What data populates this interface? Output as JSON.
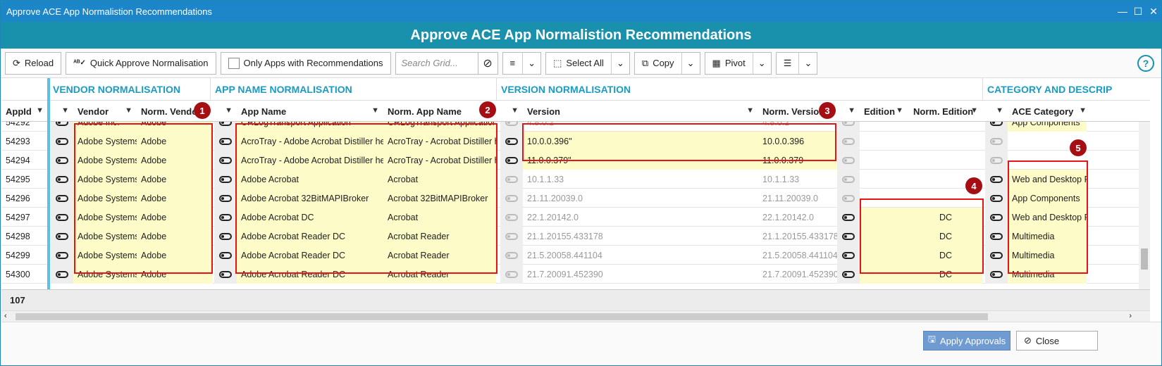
{
  "window": {
    "title": "Approve ACE App Normalistion Recommendations",
    "controls": {
      "minimize": "—",
      "maximize": "☐",
      "close": "✕"
    }
  },
  "header": {
    "title": "Approve ACE App Normalistion Recommendations"
  },
  "toolbar": {
    "reload": "Reload",
    "quick_approve": "Quick Approve Normalisation",
    "only_apps": "Only Apps with Recommendations",
    "search_placeholder": "Search Grid...",
    "select_all": "Select All",
    "copy": "Copy",
    "pivot": "Pivot",
    "help": "?"
  },
  "groups": {
    "vendor": "VENDOR NORMALISATION",
    "app": "APP NAME NORMALISATION",
    "version": "VERSION NORMALISATION",
    "category": "CATEGORY AND DESCRIP"
  },
  "columns": {
    "appid": "AppId",
    "vendor": "Vendor",
    "norm_vendor": "Norm. Vendor",
    "app_name": "App Name",
    "norm_app": "Norm. App Name",
    "version": "Version",
    "norm_version": "Norm. Version",
    "edition": "Edition",
    "norm_edition": "Norm. Edition",
    "ace_category": "ACE Category"
  },
  "rows": [
    {
      "appid": "54292",
      "vendor": "Adobe Inc.",
      "norm_vendor": "Adobe",
      "app": "CRLogTransport Application",
      "norm_app": "CRLogTransport Application",
      "version": "4.8.0.2",
      "norm_version": "4.8.0.2",
      "edition": "",
      "norm_edition": "",
      "category": "App Components"
    },
    {
      "appid": "54293",
      "vendor": "Adobe Systems",
      "norm_vendor": "Adobe",
      "app": "AcroTray - Adobe Acrobat Distiller helper",
      "norm_app": "AcroTray - Acrobat Distiller helper",
      "version": "10.0.0.396\"",
      "norm_version": "10.0.0.396",
      "edition": "",
      "norm_edition": "",
      "category": ""
    },
    {
      "appid": "54294",
      "vendor": "Adobe Systems",
      "norm_vendor": "Adobe",
      "app": "AcroTray - Adobe Acrobat Distiller helper",
      "norm_app": "AcroTray - Acrobat Distiller helper",
      "version": "11.0.0.379\"",
      "norm_version": "11.0.0.379",
      "edition": "",
      "norm_edition": "",
      "category": ""
    },
    {
      "appid": "54295",
      "vendor": "Adobe Systems",
      "norm_vendor": "Adobe",
      "app": "Adobe Acrobat",
      "norm_app": "Acrobat",
      "version": "10.1.1.33",
      "norm_version": "10.1.1.33",
      "edition": "",
      "norm_edition": "",
      "category": "Web and Desktop Publishing"
    },
    {
      "appid": "54296",
      "vendor": "Adobe Systems",
      "norm_vendor": "Adobe",
      "app": "Adobe Acrobat 32BitMAPIBroker",
      "norm_app": "Acrobat 32BitMAPIBroker",
      "version": "21.11.20039.0",
      "norm_version": "21.11.20039.0",
      "edition": "",
      "norm_edition": "",
      "category": "App Components"
    },
    {
      "appid": "54297",
      "vendor": "Adobe Systems",
      "norm_vendor": "Adobe",
      "app": "Adobe Acrobat DC",
      "norm_app": "Acrobat",
      "version": "22.1.20142.0",
      "norm_version": "22.1.20142.0",
      "edition": "",
      "norm_edition": "DC",
      "category": "Web and Desktop Publishing"
    },
    {
      "appid": "54298",
      "vendor": "Adobe Systems",
      "norm_vendor": "Adobe",
      "app": "Adobe Acrobat Reader DC",
      "norm_app": "Acrobat Reader",
      "version": "21.1.20155.433178",
      "norm_version": "21.1.20155.433178",
      "edition": "",
      "norm_edition": "DC",
      "category": "Multimedia"
    },
    {
      "appid": "54299",
      "vendor": "Adobe Systems",
      "norm_vendor": "Adobe",
      "app": "Adobe Acrobat Reader DC",
      "norm_app": "Acrobat Reader",
      "version": "21.5.20058.441104",
      "norm_version": "21.5.20058.441104",
      "edition": "",
      "norm_edition": "DC",
      "category": "Multimedia"
    },
    {
      "appid": "54300",
      "vendor": "Adobe Systems",
      "norm_vendor": "Adobe",
      "app": "Adobe Acrobat Reader DC",
      "norm_app": "Acrobat Reader",
      "version": "21.7.20091.452390",
      "norm_version": "21.7.20091.452390",
      "edition": "",
      "norm_edition": "DC",
      "category": "Multimedia"
    }
  ],
  "row_count": "107",
  "badges": [
    "1",
    "2",
    "3",
    "4",
    "5"
  ],
  "footer": {
    "apply": "Apply Approvals",
    "close": "Close"
  },
  "colors": {
    "accent": "#1990ac",
    "highlight": "#fdfbc8",
    "annotation": "#e51515"
  }
}
